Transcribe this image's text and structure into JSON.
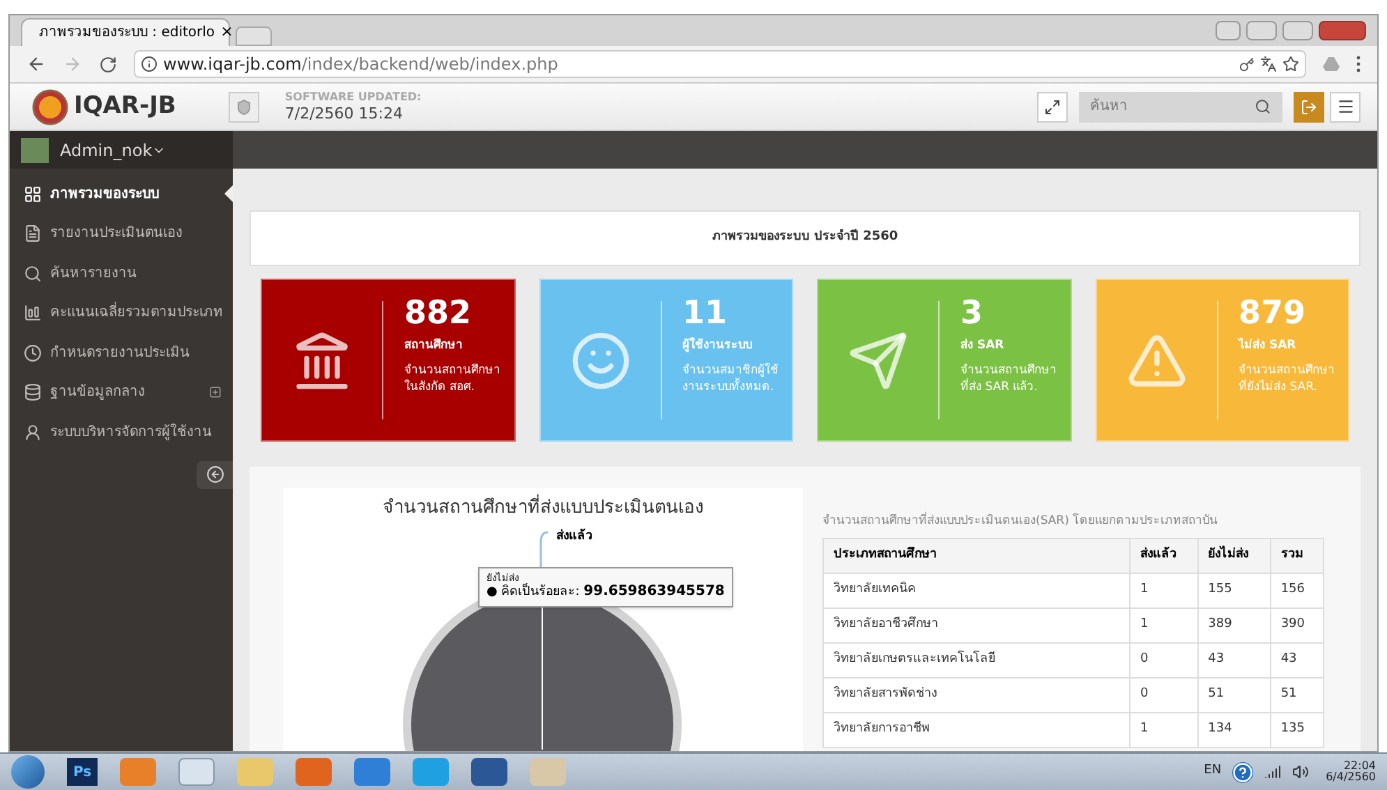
{
  "browser": {
    "tab_title": "ภาพรวมของระบบ : editorlo",
    "tab_close": "×",
    "url_host": "www.iqar-jb.com",
    "url_path": "/index/backend/web/index.php"
  },
  "header": {
    "brand": "IQAR-JB",
    "updated_label": "SOFTWARE UPDATED:",
    "updated_value": "7/2/2560 15:24",
    "search_placeholder": "ค้นหา"
  },
  "user": {
    "name": "Admin_nok"
  },
  "sidebar": {
    "items": [
      {
        "label": "ภาพรวมของระบบ",
        "selected": true,
        "expandable": false
      },
      {
        "label": "รายงานประเมินตนเอง",
        "selected": false,
        "expandable": false
      },
      {
        "label": "ค้นหารายงาน",
        "selected": false,
        "expandable": false
      },
      {
        "label": "คะแนนเฉลี่ยรวมตามประเภท",
        "selected": false,
        "expandable": false
      },
      {
        "label": "กำหนดรายงานประเมิน",
        "selected": false,
        "expandable": false
      },
      {
        "label": "ฐานข้อมูลกลาง",
        "selected": false,
        "expandable": true
      },
      {
        "label": "ระบบบริหารจัดการผู้ใช้งาน",
        "selected": false,
        "expandable": false
      }
    ]
  },
  "page_title": "ภาพรวมของระบบ ประจำปี 2560",
  "stats": [
    {
      "color": "#a80000",
      "value": "882",
      "title": "สถานศึกษา",
      "description": "จำนวนสถานศึกษา ในสังกัด สอศ."
    },
    {
      "color": "#68c1ef",
      "value": "11",
      "title": "ผู้ใช้งานระบบ",
      "description": "จำนวนสมาชิกผู้ใช้งานระบบทั้งหมด."
    },
    {
      "color": "#7bc143",
      "value": "3",
      "title": "ส่ง SAR",
      "description": "จำนวนสถานศึกษาที่ส่ง SAR แล้ว."
    },
    {
      "color": "#f8b93b",
      "value": "879",
      "title": "ไม่ส่ง SAR",
      "description": "จำนวนสถานศึกษาที่ยังไม่ส่ง SAR."
    }
  ],
  "pie": {
    "title": "จำนวนสถานศึกษาที่ส่งแบบประเมินตนเอง",
    "slice_label": "ส่งแล้ว",
    "tooltip_series": "ยังไม่ส่ง",
    "tooltip_marker": "●",
    "tooltip_label": "คิดเป็นร้อยละ:",
    "tooltip_value": "99.659863945578"
  },
  "table": {
    "caption": "จำนวนสถานศึกษาที่ส่งแบบประเมินตนเอง(SAR) โดยแยกตามประเภทสถาบัน",
    "columns": [
      "ประเภทสถานศึกษา",
      "ส่งแล้ว",
      "ยังไม่ส่ง",
      "รวม"
    ],
    "rows": [
      [
        "วิทยาลัยเทคนิค",
        "1",
        "155",
        "156"
      ],
      [
        "วิทยาลัยอาชีวศึกษา",
        "1",
        "389",
        "390"
      ],
      [
        "วิทยาลัยเกษตรและเทคโนโลยี",
        "0",
        "43",
        "43"
      ],
      [
        "วิทยาลัยสารพัดช่าง",
        "0",
        "51",
        "51"
      ],
      [
        "วิทยาลัยการอาชีพ",
        "1",
        "134",
        "135"
      ]
    ]
  },
  "taskbar": {
    "ps_label": "Ps",
    "language": "EN",
    "time": "22:04",
    "date": "6/4/2560"
  }
}
